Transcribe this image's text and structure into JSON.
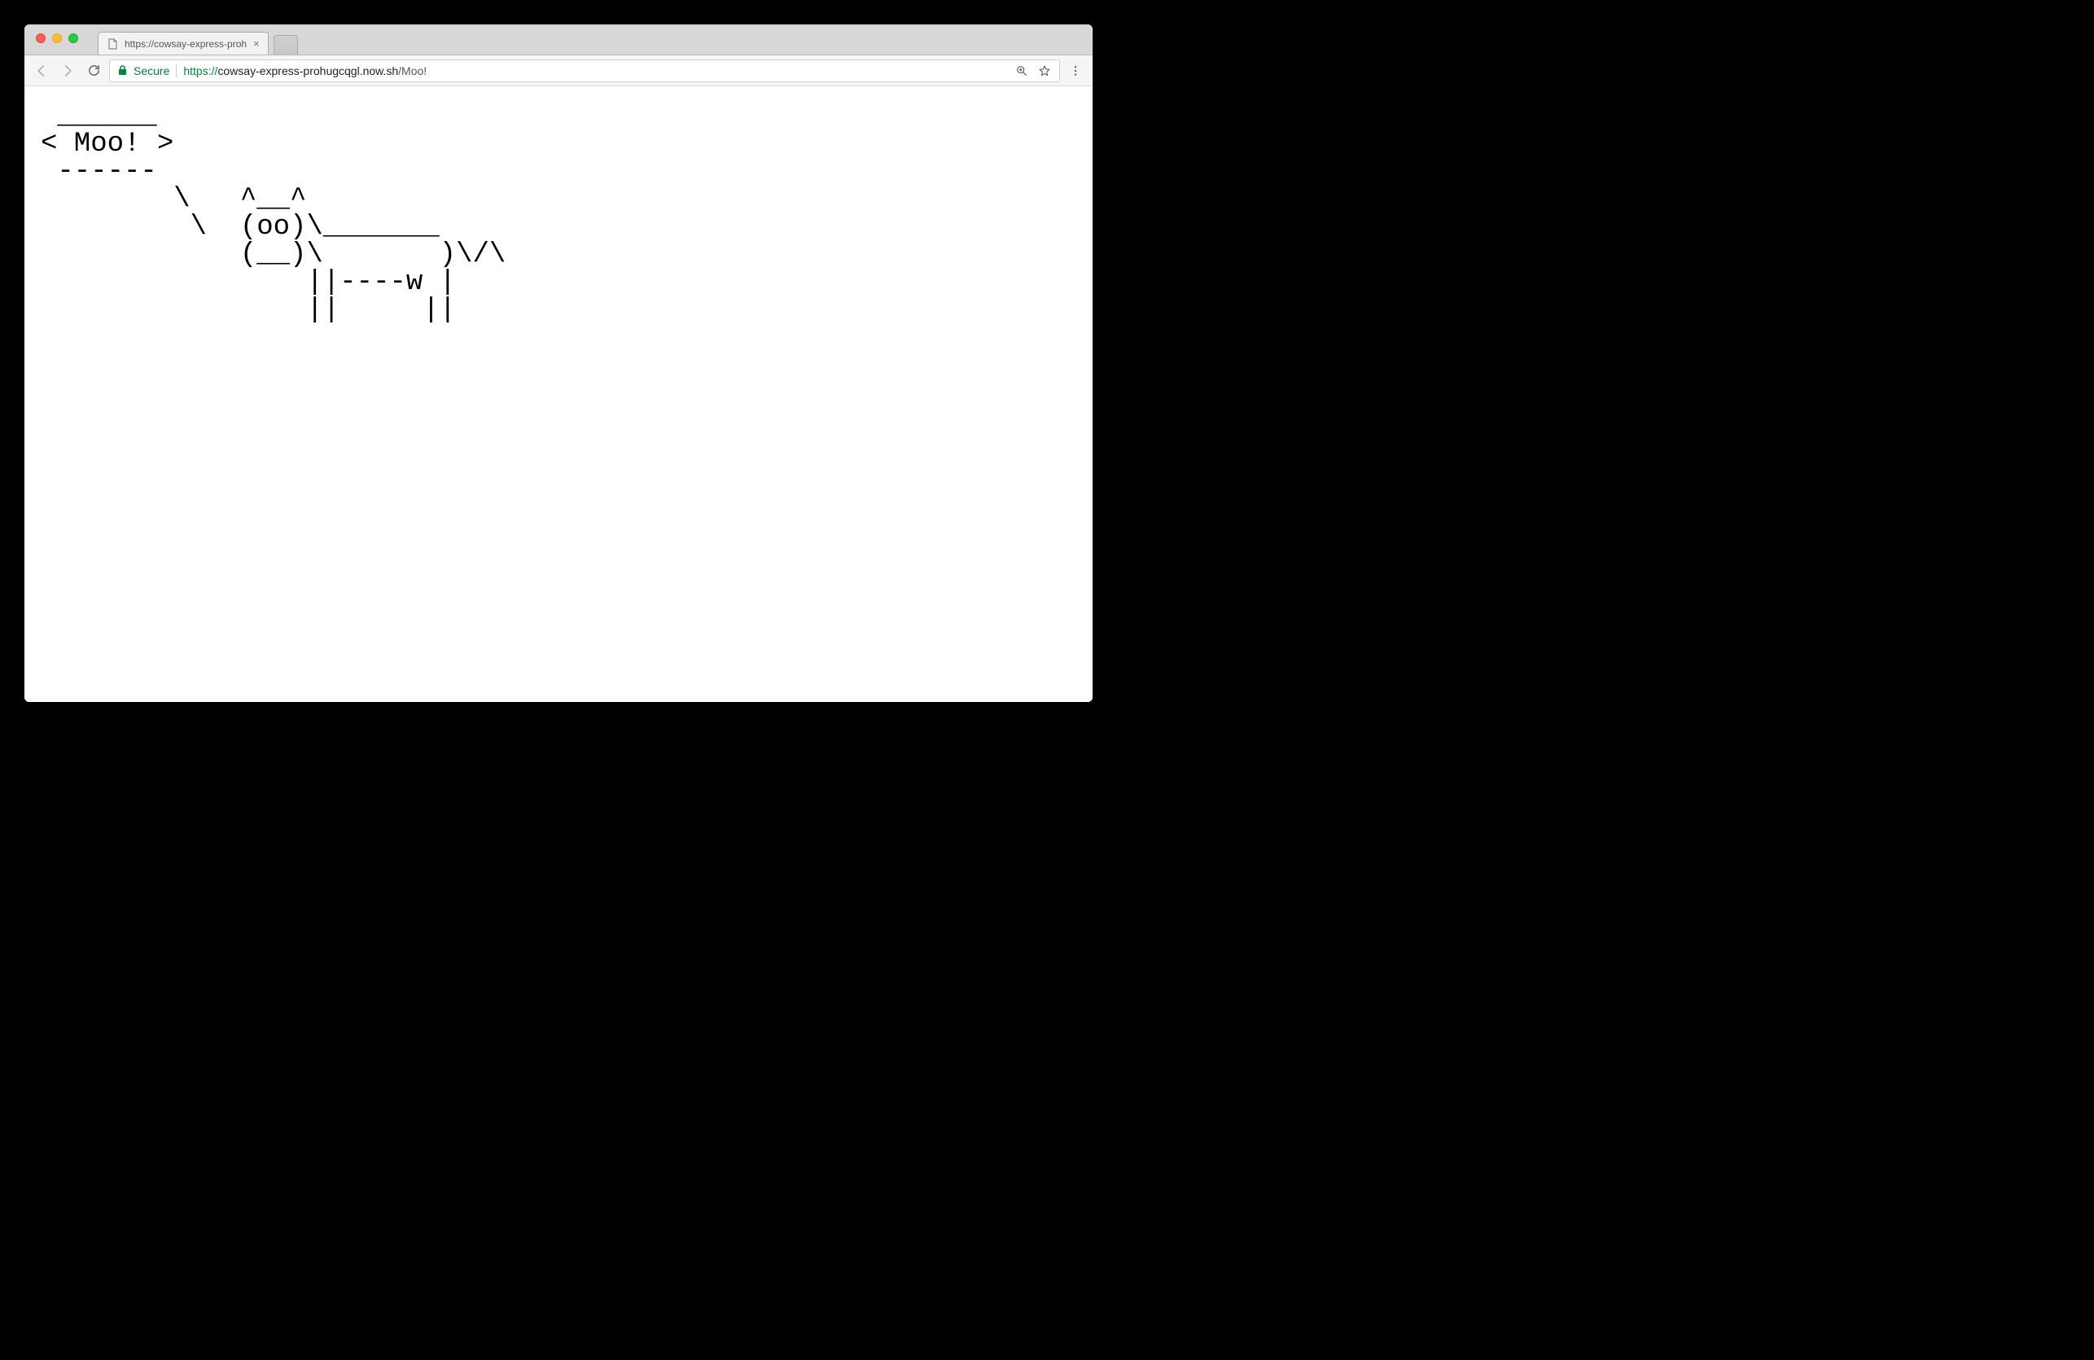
{
  "os": {
    "menu_glyph": ""
  },
  "tab": {
    "title": "https://cowsay-express-prohu",
    "close_glyph": "×"
  },
  "toolbar": {
    "secure_label": "Secure"
  },
  "url": {
    "scheme": "https://",
    "host": "cowsay-express-prohugcqgl.now.sh",
    "path": "/Moo!"
  },
  "page": {
    "cowsay": " ______\n< Moo! >\n ------\n        \\   ^__^\n         \\  (oo)\\_______\n            (__)\\       )\\/\\\n                ||----w |\n                ||     ||"
  }
}
